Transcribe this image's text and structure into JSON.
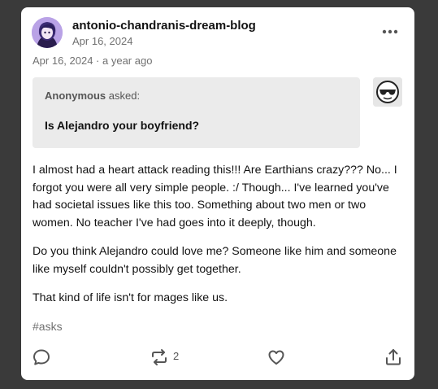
{
  "post": {
    "blog_name": "antonio-chandranis-dream-blog",
    "header_date": "Apr 16, 2024",
    "meta_line": "Apr 16, 2024 · a year ago",
    "ask": {
      "asker_name": "Anonymous",
      "asked_label": "asked:",
      "question": "Is Alejandro your boyfriend?"
    },
    "paragraphs": [
      "I almost had a heart attack reading this!!! Are Earthians crazy??? No... I forgot you were all very simple people. :/ Though... I've learned you've had societal issues like this too. Something about two men or two women. No teacher I've had goes into it deeply, though.",
      "Do you think Alejandro could love me? Someone like him and someone like myself couldn't possibly get together.",
      "That kind of life isn't for mages like us."
    ],
    "tags": [
      "#asks"
    ],
    "reblog_count": "2"
  },
  "icons": {
    "more": "more-dots-icon",
    "reply": "reply-bubble-icon",
    "reblog": "reblog-icon",
    "like": "heart-icon",
    "share": "share-icon"
  },
  "colors": {
    "background": "#3a3a3a",
    "card": "#ffffff",
    "ask_box": "#ebebeb",
    "text": "#121212",
    "muted": "#717171"
  }
}
